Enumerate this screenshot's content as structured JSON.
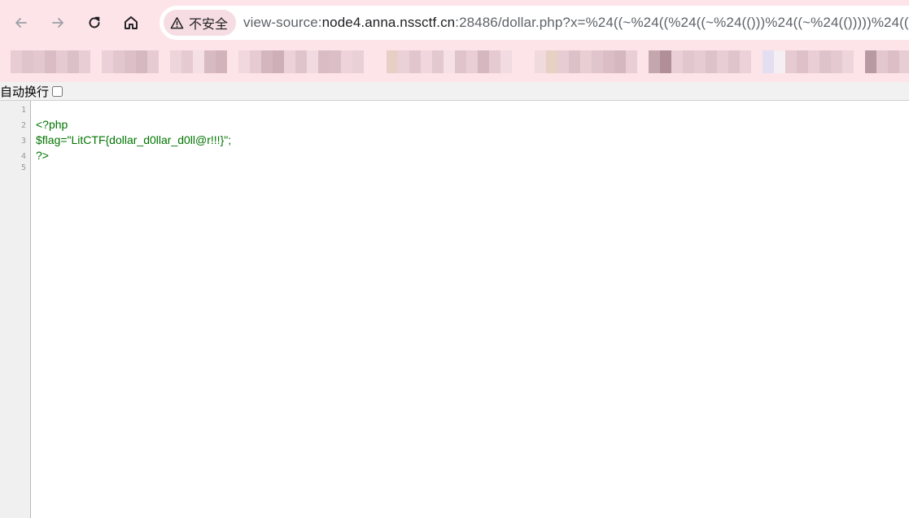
{
  "toolbar": {
    "back_icon": "arrow-left-icon",
    "forward_icon": "arrow-right-icon",
    "reload_icon": "reload-icon",
    "home_icon": "home-icon"
  },
  "omnibox": {
    "security_icon": "warning-triangle-icon",
    "security_label": "不安全",
    "url_prefix": "view-source:",
    "url_host": "node4.anna.nssctf.cn",
    "url_rest": ":28486/dollar.php?x=%24((~%24((%24((~%24(()))%24((~%24(()))))%24((~%24(()))))%24"
  },
  "wrap": {
    "label": "自动换行",
    "checked": false
  },
  "source": {
    "line_numbers": [
      "1",
      "2",
      "3",
      "4",
      "5"
    ],
    "lines": [
      "",
      "<?php",
      "$flag=\"LitCTF{dollar_d0llar_d0ll@r!!!}\";",
      "?>",
      ""
    ]
  },
  "colors": {
    "chrome_bg": "#fde4e9",
    "code_text": "#007400",
    "gutter_bg": "#f0f0f0"
  }
}
